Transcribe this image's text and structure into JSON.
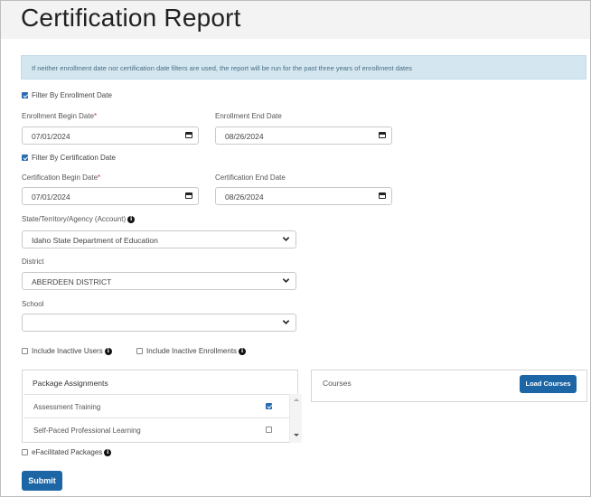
{
  "page": {
    "title": "Certification Report"
  },
  "alert": {
    "text": "If neither enrollment date nor certification date filters are used, the report will be run for the past three years of enrollment dates"
  },
  "enrollment": {
    "filter_label": "Filter By Enrollment Date",
    "filter_checked": true,
    "begin_label": "Enrollment Begin Date",
    "begin_required": "*",
    "begin_value": "07/01/2024",
    "end_label": "Enrollment End Date",
    "end_value": "08/26/2024"
  },
  "certification": {
    "filter_label": "Filter By Certification Date",
    "filter_checked": true,
    "begin_label": "Certification Begin Date",
    "begin_required": "*",
    "begin_value": "07/01/2024",
    "end_label": "Certification End Date",
    "end_value": "08/26/2024"
  },
  "account": {
    "label": "State/Territory/Agency (Account)",
    "value": "Idaho State Department of Education"
  },
  "district": {
    "label": "District",
    "value": "ABERDEEN DISTRICT"
  },
  "school": {
    "label": "School",
    "value": ""
  },
  "options": {
    "inactive_users_label": "Include Inactive Users",
    "inactive_users_checked": false,
    "inactive_enrollments_label": "Include Inactive Enrollments",
    "inactive_enrollments_checked": false
  },
  "packages": {
    "header": "Package Assignments",
    "items": [
      {
        "label": "Assessment Training",
        "checked": true
      },
      {
        "label": "Self-Paced Professional Learning",
        "checked": false
      }
    ]
  },
  "courses": {
    "header": "Courses",
    "load_button": "Load Courses"
  },
  "efacilitated": {
    "label": "eFacilitated Packages",
    "checked": false
  },
  "submit": {
    "label": "Submit"
  },
  "colors": {
    "accent": "#1d66a6",
    "alert_bg": "#d4e7f1",
    "required": "#c0392b"
  },
  "icons": {
    "calendar": "calendar-icon",
    "chevron": "chevron-down-icon",
    "info": "info-icon"
  }
}
